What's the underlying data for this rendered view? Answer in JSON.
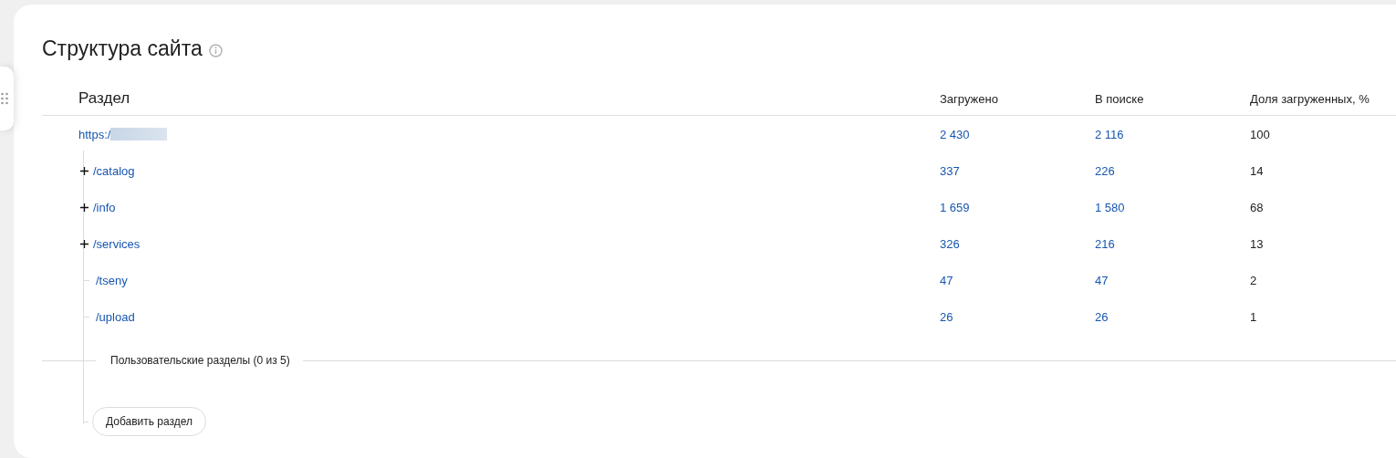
{
  "title": "Структура сайта",
  "table": {
    "columns": [
      "Раздел",
      "Загружено",
      "В поиске",
      "Доля загруженных, %"
    ],
    "root": {
      "section": "https:/",
      "loaded": "2 430",
      "in_search": "2 116",
      "share": "100",
      "children": [
        {
          "kind": "expandable",
          "section": "/catalog",
          "loaded": "337",
          "in_search": "226",
          "share": "14"
        },
        {
          "kind": "expandable",
          "section": "/info",
          "loaded": "1 659",
          "in_search": "1 580",
          "share": "68"
        },
        {
          "kind": "expandable",
          "section": "/services",
          "loaded": "326",
          "in_search": "216",
          "share": "13"
        },
        {
          "kind": "leaf",
          "section": "/tseny",
          "loaded": "47",
          "in_search": "47",
          "share": "2"
        },
        {
          "kind": "leaf",
          "section": "/upload",
          "loaded": "26",
          "in_search": "26",
          "share": "1"
        }
      ]
    }
  },
  "custom_sections": {
    "label": "Пользовательские разделы (0 из 5)"
  },
  "add_button": "Добавить раздел"
}
